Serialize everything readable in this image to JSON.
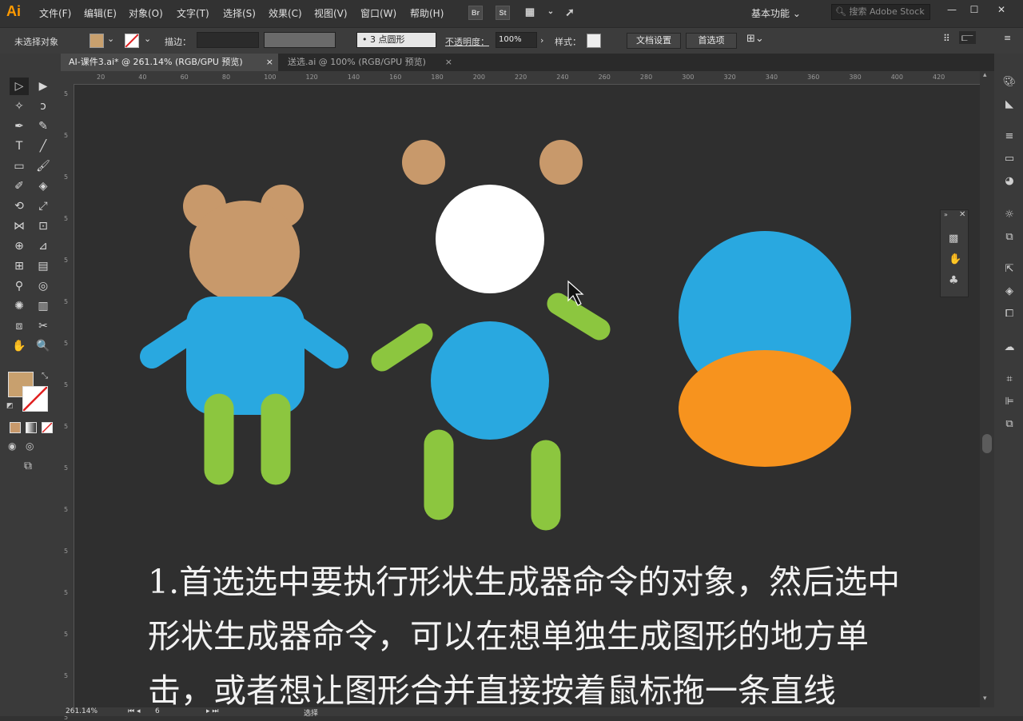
{
  "app": {
    "logo_text": "Ai",
    "menu": [
      "文件(F)",
      "编辑(E)",
      "对象(O)",
      "文字(T)",
      "选择(S)",
      "效果(C)",
      "视图(V)",
      "窗口(W)",
      "帮助(H)"
    ],
    "bridge_label": "Br",
    "stock_label": "St",
    "workspace_label": "基本功能",
    "stock_search_placeholder": "搜索 Adobe Stock",
    "window_buttons": [
      "—",
      "☐",
      "✕"
    ]
  },
  "control_bar": {
    "selection_status": "未选择对象",
    "stroke_label": "描边：",
    "brush_dot": "•",
    "brush_label": "3 点圆形",
    "opacity_label": "不透明度：",
    "opacity_value": "100%",
    "style_label": "样式：",
    "doc_setup_button": "文档设置",
    "preferences_button": "首选项",
    "fill_color": "#c8a06e"
  },
  "tabs": [
    {
      "label": "AI-课件3.ai* @ 261.14% (RGB/GPU 预览)",
      "close": "×",
      "active": true
    },
    {
      "label": "送选.ai @ 100% (RGB/GPU 预览)",
      "close": "×",
      "active": false
    }
  ],
  "ruler": {
    "top_ticks": [
      "20",
      "40",
      "60",
      "80",
      "100",
      "120",
      "140",
      "160",
      "180",
      "200",
      "220",
      "240",
      "260",
      "280",
      "300",
      "320",
      "340",
      "360",
      "380",
      "400",
      "420"
    ],
    "left_ticks": [
      "5",
      "5",
      "5",
      "5",
      "5",
      "5",
      "5",
      "5",
      "5",
      "5",
      "5",
      "5",
      "5",
      "5",
      "5",
      "5"
    ]
  },
  "canvas": {
    "colors": {
      "bear_tan": "#c8996b",
      "blue": "#29a8e0",
      "green": "#8cc63f",
      "white": "#ffffff",
      "orange": "#f7931e",
      "artboard": "#2f2f2f"
    },
    "instruction_lines": [
      "1.首选选中要执行形状生成器命令的对象，然后选中",
      "形状生成器命令，可以在想单独生成图形的地方单",
      "击，或者想让图形合并直接按着鼠标拖一条直线"
    ]
  },
  "status_bar": {
    "zoom": "261.14%",
    "page": "6",
    "tool_name": "选择"
  },
  "tools": [
    {
      "name": "selection-tool",
      "glyph": "▷"
    },
    {
      "name": "direct-selection-tool",
      "glyph": "▶"
    },
    {
      "name": "magic-wand-tool",
      "glyph": "✧"
    },
    {
      "name": "lasso-tool",
      "glyph": "ↄ"
    },
    {
      "name": "pen-tool",
      "glyph": "✒"
    },
    {
      "name": "curvature-tool",
      "glyph": "✎"
    },
    {
      "name": "type-tool",
      "glyph": "T"
    },
    {
      "name": "line-tool",
      "glyph": "╱"
    },
    {
      "name": "rectangle-tool",
      "glyph": "▭"
    },
    {
      "name": "paintbrush-tool",
      "glyph": "🖌"
    },
    {
      "name": "shaper-tool",
      "glyph": "✐"
    },
    {
      "name": "eraser-tool",
      "glyph": "◈"
    },
    {
      "name": "rotate-tool",
      "glyph": "⟲"
    },
    {
      "name": "scale-tool",
      "glyph": "⤢"
    },
    {
      "name": "width-tool",
      "glyph": "⋈"
    },
    {
      "name": "free-transform-tool",
      "glyph": "⊡"
    },
    {
      "name": "shape-builder-tool",
      "glyph": "⊕"
    },
    {
      "name": "perspective-grid-tool",
      "glyph": "⊿"
    },
    {
      "name": "mesh-tool",
      "glyph": "⊞"
    },
    {
      "name": "gradient-tool",
      "glyph": "▤"
    },
    {
      "name": "eyedropper-tool",
      "glyph": "⚲"
    },
    {
      "name": "blend-tool",
      "glyph": "◎"
    },
    {
      "name": "symbol-sprayer-tool",
      "glyph": "✺"
    },
    {
      "name": "column-graph-tool",
      "glyph": "▥"
    },
    {
      "name": "artboard-tool",
      "glyph": "⧈"
    },
    {
      "name": "slice-tool",
      "glyph": "✂"
    },
    {
      "name": "hand-tool",
      "glyph": "✋"
    },
    {
      "name": "zoom-tool",
      "glyph": "🔍"
    }
  ]
}
